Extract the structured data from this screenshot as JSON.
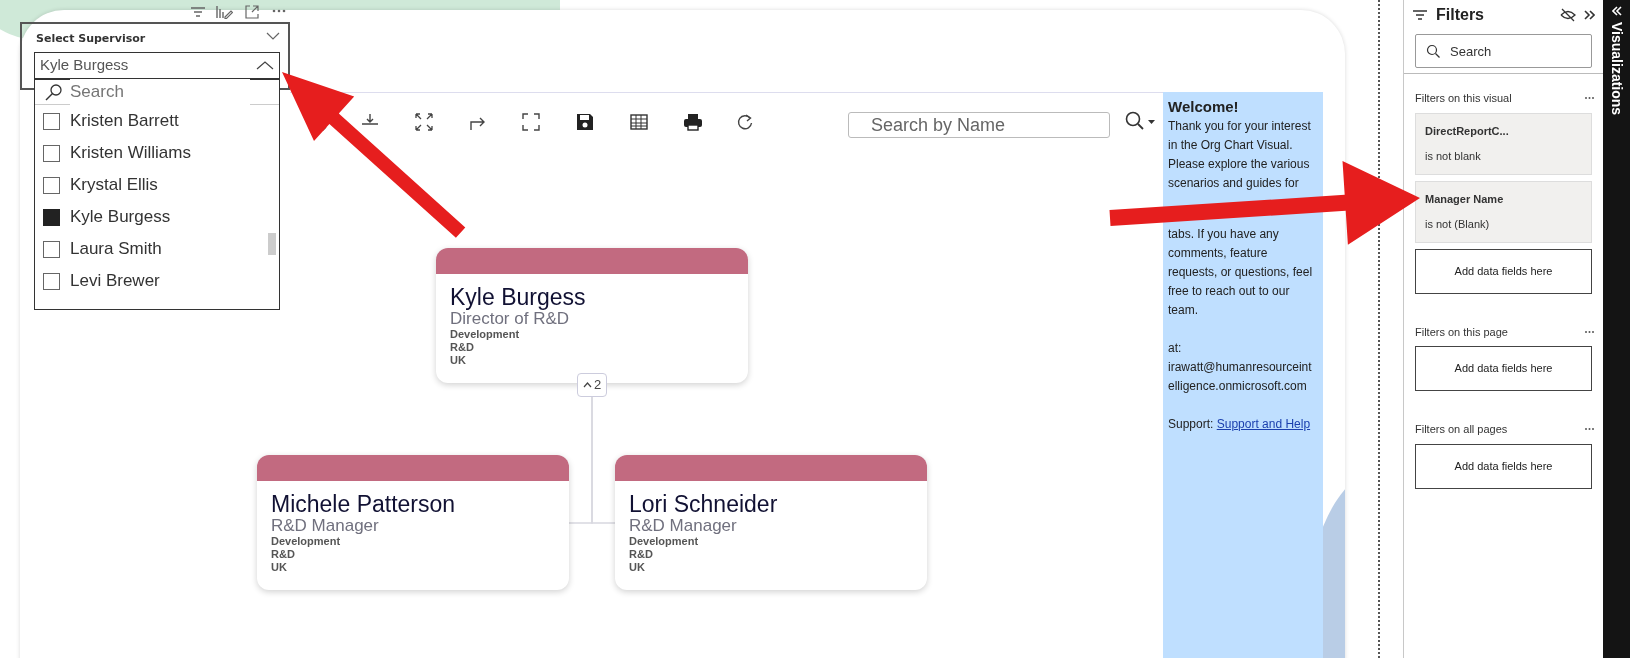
{
  "slicer": {
    "title": "Select Supervisor",
    "value": "Kyle Burgess",
    "expanded": true,
    "search_placeholder": "Search",
    "items": [
      {
        "label": "Kristen Barrett",
        "selected": false
      },
      {
        "label": "Kristen Williams",
        "selected": false
      },
      {
        "label": "Krystal Ellis",
        "selected": false
      },
      {
        "label": "Kyle Burgess",
        "selected": true
      },
      {
        "label": "Laura Smith",
        "selected": false
      },
      {
        "label": "Levi Brewer",
        "selected": false
      }
    ]
  },
  "org_chart": {
    "search_placeholder": "Search by Name",
    "nodes": [
      {
        "name": "Kyle Burgess",
        "title": "Director of R&D",
        "details": [
          "Development",
          "R&D",
          "UK"
        ],
        "child_count": "2",
        "expanded": true,
        "children": [
          {
            "name": "Michele Patterson",
            "title": "R&D Manager",
            "details": [
              "Development",
              "R&D",
              "UK"
            ]
          },
          {
            "name": "Lori Schneider",
            "title": "R&D Manager",
            "details": [
              "Development",
              "R&D",
              "UK"
            ]
          }
        ]
      }
    ]
  },
  "welcome": {
    "heading": "Welcome!",
    "paragraphs": [
      "Thank you for your interest in the Org Chart Visual. Please explore the various scenarios and guides for",
      "tabs. If you have any comments, feature requests, or questions, feel free to reach out to our team."
    ],
    "contact_label": "at:",
    "email": "irawatt@humanresourceintelligence.onmicrosoft.com",
    "support_label": "Support:",
    "support_link": "Support and Help"
  },
  "filters": {
    "title": "Filters",
    "search_placeholder": "Search",
    "sections": [
      {
        "title": "Filters on this visual",
        "cards": [
          {
            "kind": "filter",
            "field": "DirectReportC...",
            "condition": "is not blank"
          },
          {
            "kind": "filter",
            "field": "Manager Name",
            "condition": "is not (Blank)"
          },
          {
            "kind": "drop",
            "text": "Add data fields here"
          }
        ]
      },
      {
        "title": "Filters on this page",
        "cards": [
          {
            "kind": "drop",
            "text": "Add data fields here"
          }
        ]
      },
      {
        "title": "Filters on all pages",
        "cards": [
          {
            "kind": "drop",
            "text": "Add data fields here"
          }
        ]
      }
    ]
  },
  "visualizations": {
    "title": "Visualizations"
  }
}
